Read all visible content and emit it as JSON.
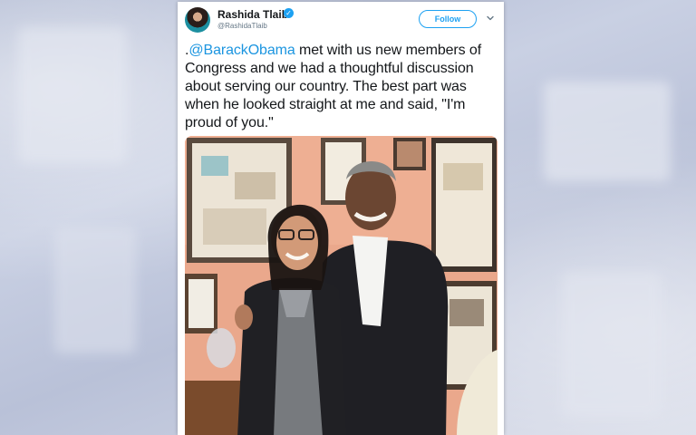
{
  "tweet": {
    "author": {
      "display_name": "Rashida Tlaib",
      "handle": "@RashidaTlaib",
      "verified_icon": "verified-badge-icon",
      "avatar_icon": "avatar"
    },
    "follow_label": "Follow",
    "menu_icon": "chevron-down-icon",
    "text": {
      "prefix": ".",
      "mention": "@BarackObama",
      "body": " met with us new members of Congress and we had a thoughtful discussion about serving our country. The best part was when he looked straight at me and said, \"I'm proud of you.\""
    },
    "photo": {
      "subject": "two-people-standing-photo"
    }
  },
  "colors": {
    "link_blue": "#1b95e0",
    "verified_blue": "#1da1f2",
    "text_dark": "#14171a",
    "handle_gray": "#657786",
    "wall_salmon": "#e9a98d"
  }
}
